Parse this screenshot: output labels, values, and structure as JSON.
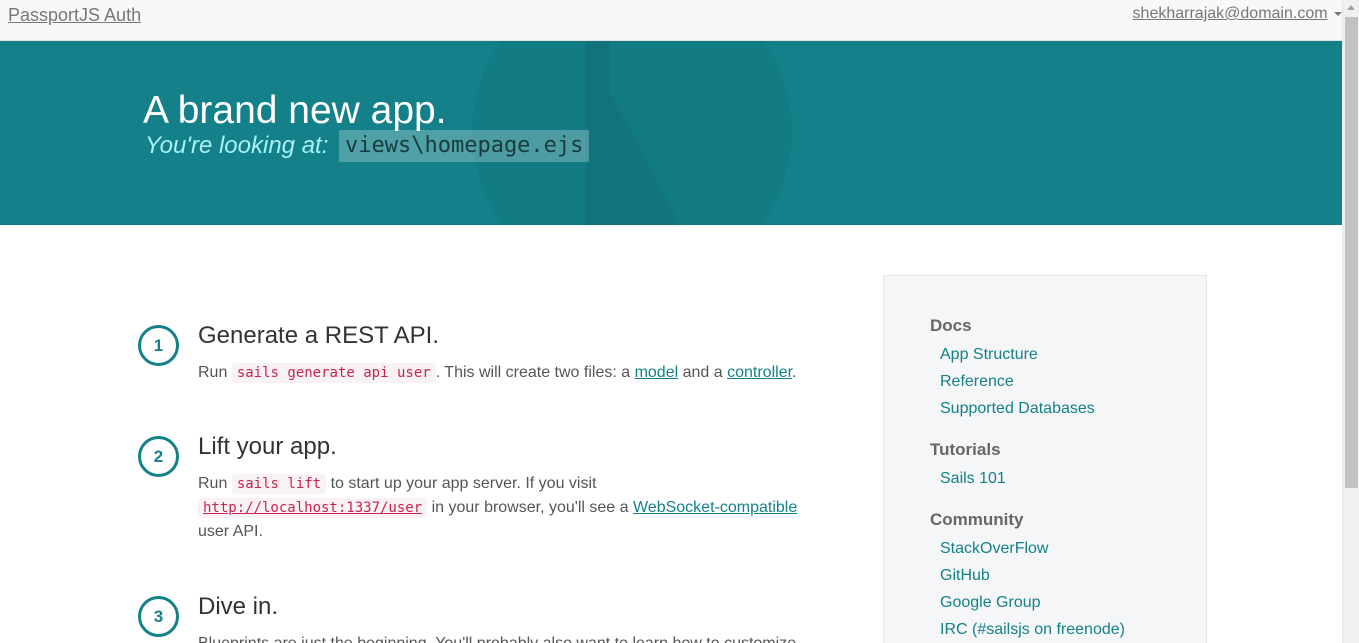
{
  "navbar": {
    "brand": "PassportJS Auth",
    "user_email": "shekharrajak@domain.com"
  },
  "hero": {
    "title": "A brand new app.",
    "subtitle": "You're looking at:",
    "file_path": "views\\homepage.ejs"
  },
  "steps": [
    {
      "number": "1",
      "title": "Generate a REST API.",
      "run_label": "Run",
      "command": "sails generate api user",
      "text_after": ". This will create two files: a",
      "link_model": "model",
      "text_and": "and a",
      "link_controller": "controller",
      "period": "."
    },
    {
      "number": "2",
      "title": "Lift your app.",
      "run_label": "Run",
      "command": "sails lift",
      "text_after": "to start up your app server. If you visit",
      "url": "http://localhost:1337/user",
      "text_browser": "in your browser, you'll see a",
      "link_websocket": "WebSocket-compatible",
      "text_end": "user API."
    },
    {
      "number": "3",
      "title": "Dive in.",
      "text": "Blueprints are just the beginning. You'll probably also want to learn how to customize"
    }
  ],
  "sidebar": {
    "docs_heading": "Docs",
    "docs_links": [
      "App Structure",
      "Reference",
      "Supported Databases"
    ],
    "tutorials_heading": "Tutorials",
    "tutorials_links": [
      "Sails 101"
    ],
    "community_heading": "Community",
    "community_links": [
      "StackOverFlow",
      "GitHub",
      "Google Group",
      "IRC (#sailsjs on freenode)"
    ]
  },
  "colors": {
    "hero_bg": "#14818a",
    "accent": "#14818a",
    "code_text": "#c7254e"
  }
}
